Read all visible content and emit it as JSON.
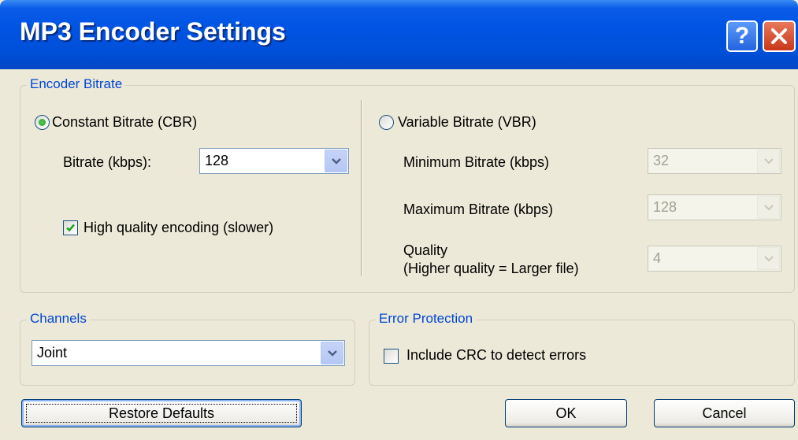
{
  "window": {
    "title": "MP3 Encoder Settings",
    "help_label": "?"
  },
  "encoder_bitrate": {
    "legend": "Encoder Bitrate",
    "cbr": {
      "label": "Constant Bitrate (CBR)",
      "selected": true,
      "bitrate_label": "Bitrate (kbps):",
      "bitrate_value": "128",
      "hq_label": "High quality encoding (slower)",
      "hq_checked": true
    },
    "vbr": {
      "label": "Variable Bitrate (VBR)",
      "selected": false,
      "min_label": "Minimum Bitrate (kbps)",
      "min_value": "32",
      "max_label": "Maximum Bitrate (kbps)",
      "max_value": "128",
      "quality_label_1": "Quality",
      "quality_label_2": "(Higher quality = Larger file)",
      "quality_value": "4"
    }
  },
  "channels": {
    "legend": "Channels",
    "value": "Joint"
  },
  "error_protection": {
    "legend": "Error Protection",
    "crc_label": "Include CRC to detect errors",
    "crc_checked": false
  },
  "buttons": {
    "restore": "Restore Defaults",
    "ok": "OK",
    "cancel": "Cancel"
  },
  "colors": {
    "titlebar": "#0054E3",
    "legend_text": "#0046D5",
    "dialog_bg": "#ECE9D8"
  }
}
